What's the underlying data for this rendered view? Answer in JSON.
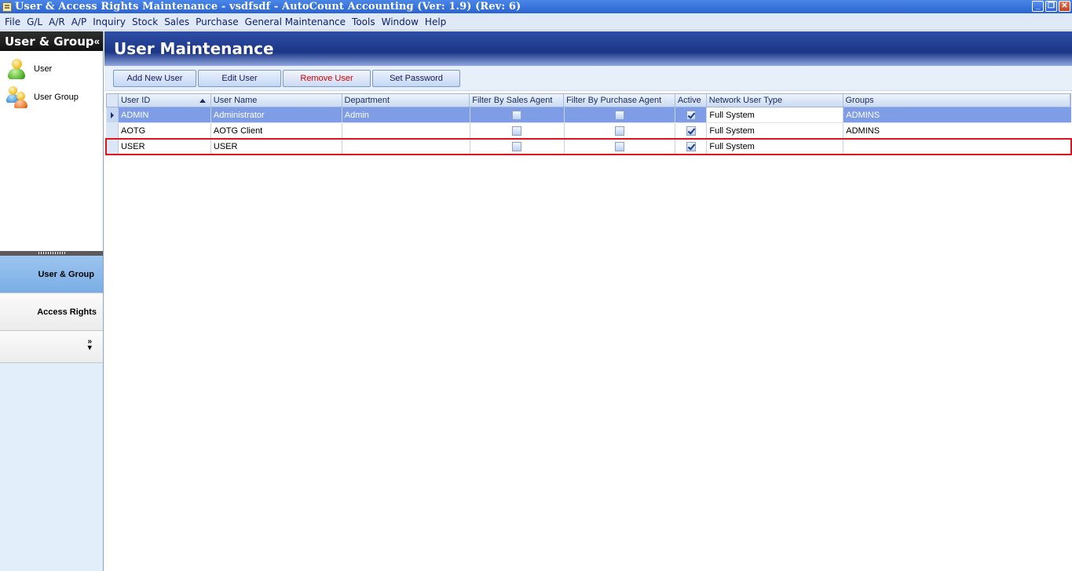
{
  "window": {
    "title": "User & Access Rights Maintenance - vsdfsdf - AutoCount Accounting (Ver: 1.9) (Rev: 6)",
    "buttons": [
      "minimize",
      "restore",
      "close"
    ]
  },
  "menu": [
    "File",
    "G/L",
    "A/R",
    "A/P",
    "Inquiry",
    "Stock",
    "Sales",
    "Purchase",
    "General Maintenance",
    "Tools",
    "Window",
    "Help"
  ],
  "sidebar": {
    "title": "User & Group",
    "collapse_glyph": "«",
    "items": [
      {
        "label": "User",
        "icon": "user-icon"
      },
      {
        "label": "User Group",
        "icon": "user-group-icon"
      }
    ],
    "nav_buttons": [
      {
        "label": "User & Group",
        "selected": true
      },
      {
        "label": "Access Rights",
        "selected": false
      }
    ],
    "overflow_glyph": "»"
  },
  "main": {
    "title": "User Maintenance",
    "toolbar": {
      "add_label": "Add New User",
      "edit_label": "Edit User",
      "remove_label": "Remove User",
      "password_label": "Set Password"
    },
    "grid": {
      "columns": [
        "User ID",
        "User Name",
        "Department",
        "Filter By Sales Agent",
        "Filter By Purchase Agent",
        "Active",
        "Network User Type",
        "Groups"
      ],
      "sort_column": "User ID",
      "sort_direction": "ascending",
      "rows": [
        {
          "user_id": "ADMIN",
          "user_name": "Administrator",
          "department": "Admin",
          "filter_sales": false,
          "filter_purchase": false,
          "active": true,
          "network_type": "Full System",
          "groups": "ADMINS",
          "selected": true
        },
        {
          "user_id": "AOTG",
          "user_name": "AOTG Client",
          "department": "",
          "filter_sales": false,
          "filter_purchase": false,
          "active": true,
          "network_type": "Full System",
          "groups": "ADMINS",
          "selected": false
        },
        {
          "user_id": "USER",
          "user_name": "USER",
          "department": "",
          "filter_sales": false,
          "filter_purchase": false,
          "active": true,
          "network_type": "Full System",
          "groups": "",
          "highlighted": true
        }
      ]
    }
  },
  "colors": {
    "titlebar": "#2b64d0",
    "banner": "#1b3585",
    "selected_row": "#7f9ce6",
    "highlight_outline": "#e0141e",
    "remove_text": "#d40000"
  }
}
